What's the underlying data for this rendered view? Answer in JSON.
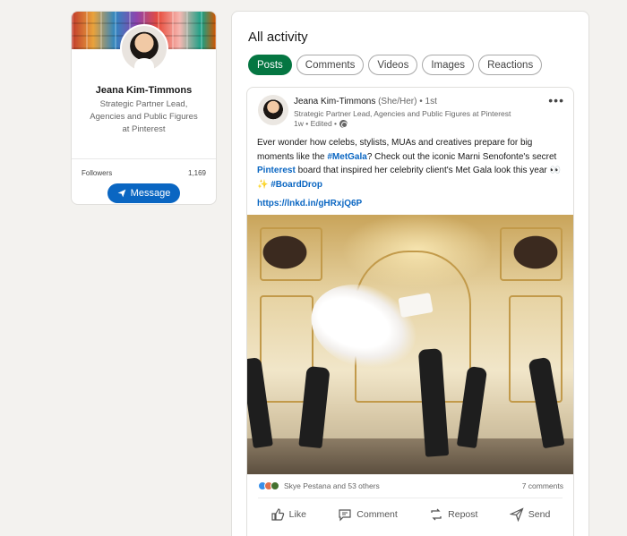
{
  "profile": {
    "name": "Jeana Kim-Timmons",
    "headline": "Strategic Partner Lead, Agencies and Public Figures at Pinterest",
    "followers_label": "Followers",
    "followers_count": "1,169",
    "message_label": "Message"
  },
  "activity": {
    "title": "All activity",
    "filters": [
      {
        "label": "Posts",
        "active": true
      },
      {
        "label": "Comments",
        "active": false
      },
      {
        "label": "Videos",
        "active": false
      },
      {
        "label": "Images",
        "active": false
      },
      {
        "label": "Reactions",
        "active": false
      }
    ]
  },
  "post": {
    "author_name": "Jeana Kim-Timmons",
    "author_pronouns": " (She/Her) • 1st",
    "author_headline": "Strategic Partner Lead, Agencies and Public Figures at Pinterest",
    "time": "1w • Edited •",
    "more_label": "•••",
    "text_part1": "Ever wonder how celebs, stylists, MUAs and creatives prepare for big moments like the ",
    "hashtag1": "#MetGala",
    "text_part2": "? Check out the iconic Marni Senofonte's secret ",
    "mention": "Pinterest",
    "text_part3": " board that inspired her celebrity client's Met Gala look this year 👀✨ ",
    "hashtag2": "#BoardDrop",
    "url": "https://lnkd.in/gHRxjQ6P",
    "reactions_text": "Skye Pestana and 53 others",
    "comments_text": "7 comments",
    "actions": {
      "like": "Like",
      "comment": "Comment",
      "repost": "Repost",
      "send": "Send"
    }
  },
  "colors": {
    "accent_blue": "#0a66c2",
    "active_green": "#057642"
  }
}
